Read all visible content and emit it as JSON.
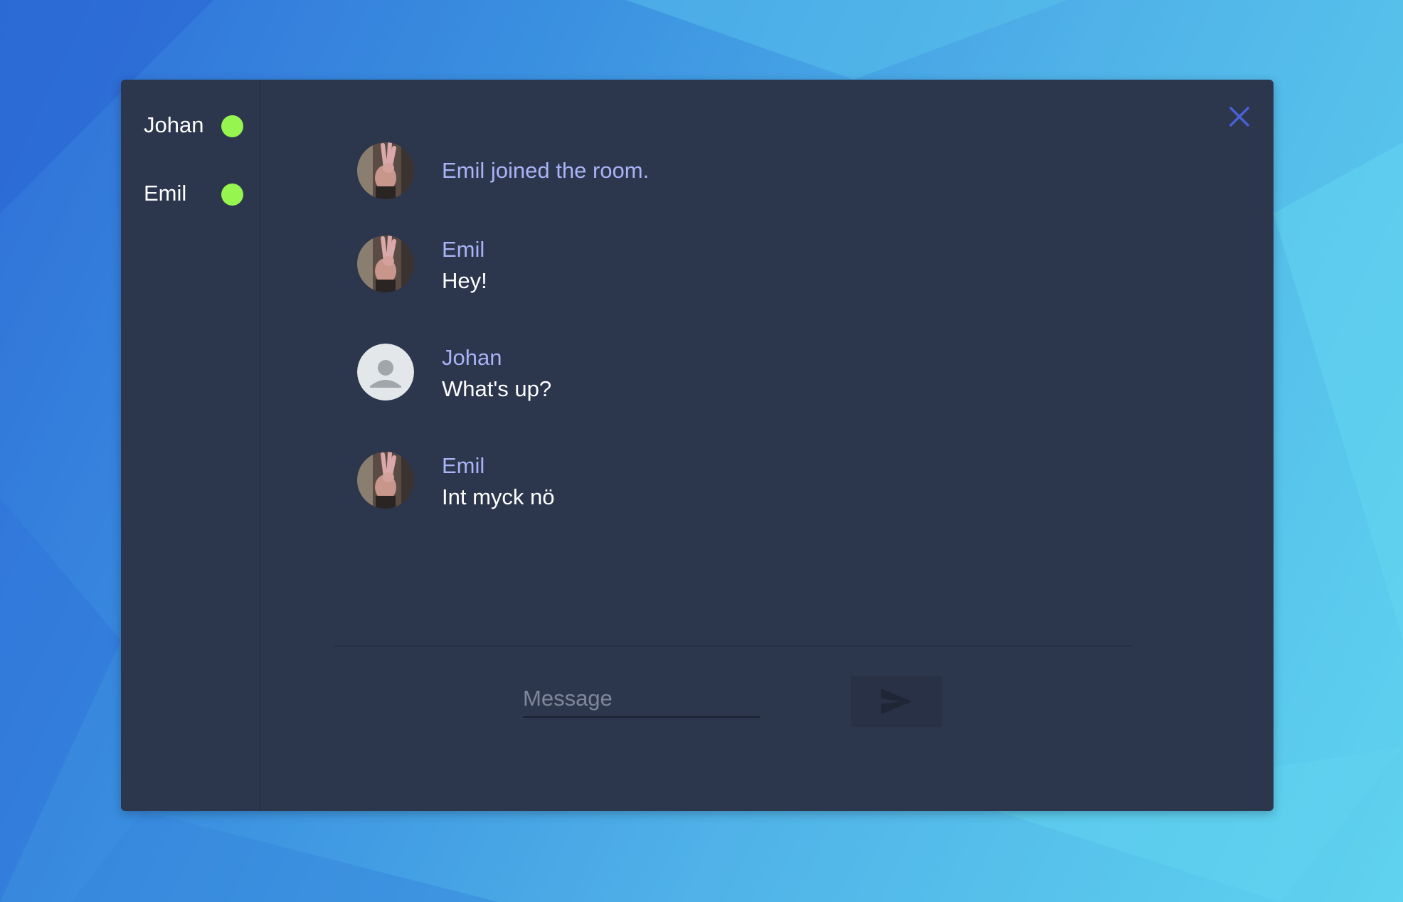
{
  "users": [
    {
      "name": "Johan",
      "status": "online",
      "status_color": "#97f54f"
    },
    {
      "name": "Emil",
      "status": "online",
      "status_color": "#97f54f"
    }
  ],
  "messages": [
    {
      "type": "system",
      "avatar": "emil-photo",
      "text": "Emil joined the room."
    },
    {
      "type": "chat",
      "author": "Emil",
      "avatar": "emil-photo",
      "text": "Hey!"
    },
    {
      "type": "chat",
      "author": "Johan",
      "avatar": "default-avatar",
      "text": "What's up?"
    },
    {
      "type": "chat",
      "author": "Emil",
      "avatar": "emil-photo",
      "text": "Int myck nö"
    }
  ],
  "composer": {
    "placeholder": "Message",
    "value": "",
    "send_icon": "send-icon"
  },
  "colors": {
    "window_bg": "#2c364d",
    "author": "#a9b3f5",
    "close": "#4b5fd6",
    "online": "#97f54f"
  }
}
